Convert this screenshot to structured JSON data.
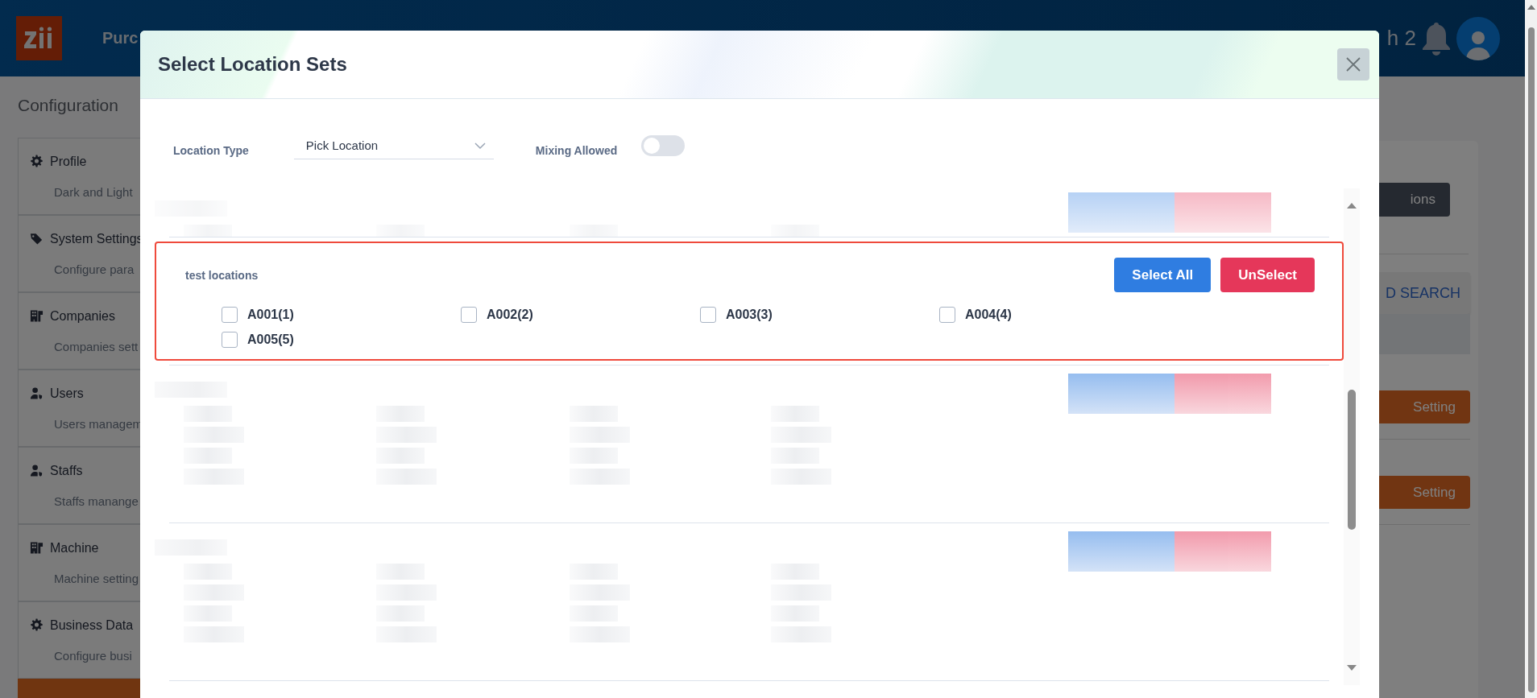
{
  "app_header": {
    "title_fragment": "Purc",
    "user_fragment": "h 2"
  },
  "page": {
    "title": "Configuration"
  },
  "sidebar": {
    "items": [
      {
        "kind": "gear",
        "title": "Profile",
        "subtitle": "Dark and Light"
      },
      {
        "kind": "tag",
        "title": "System Settings",
        "subtitle": "Configure para"
      },
      {
        "kind": "building",
        "title": "Companies",
        "subtitle": "Companies sett"
      },
      {
        "kind": "user",
        "title": "Users",
        "subtitle": "Users managem"
      },
      {
        "kind": "user",
        "title": "Staffs",
        "subtitle": "Staffs manange"
      },
      {
        "kind": "building",
        "title": "Machine",
        "subtitle": "Machine setting"
      },
      {
        "kind": "gear",
        "title": "Business Data",
        "subtitle": "Configure busi"
      }
    ]
  },
  "background_fragments": {
    "action_button": "ions",
    "search_button": "D SEARCH",
    "setting_buttons": [
      "Setting",
      "Setting"
    ]
  },
  "dialog": {
    "title": "Select Location Sets",
    "location_type": {
      "label": "Location Type",
      "value": "Pick Location"
    },
    "mixing_allowed": {
      "label": "Mixing Allowed",
      "on": false
    },
    "location_sets": [
      {
        "kind": "redacted-partial"
      },
      {
        "kind": "group",
        "name": "test locations",
        "highlighted": true,
        "select_all": "Select All",
        "unselect": "UnSelect",
        "locations": [
          {
            "label": "A001(1)",
            "checked": false
          },
          {
            "label": "A002(2)",
            "checked": false
          },
          {
            "label": "A003(3)",
            "checked": false
          },
          {
            "label": "A004(4)",
            "checked": false
          },
          {
            "label": "A005(5)",
            "checked": false
          }
        ]
      },
      {
        "kind": "redacted"
      },
      {
        "kind": "redacted"
      }
    ]
  }
}
